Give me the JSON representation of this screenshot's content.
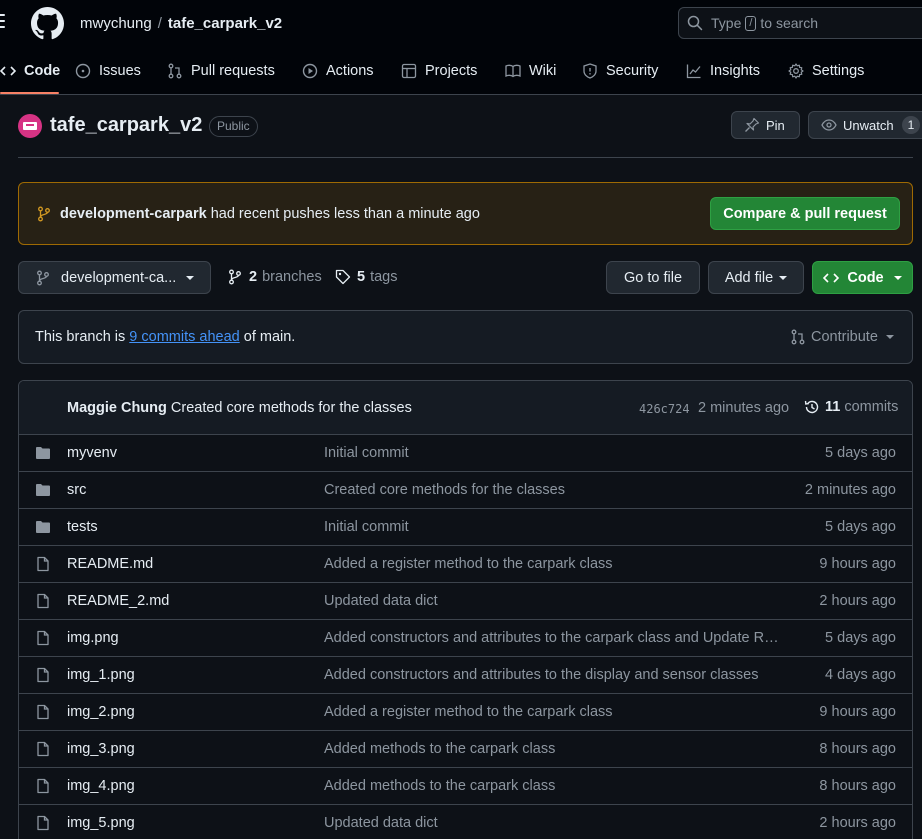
{
  "header": {
    "owner": "mwychung",
    "separator": "/",
    "repo": "tafe_carpark_v2",
    "search": {
      "prefix": "Type",
      "key": "/",
      "suffix": "to search"
    }
  },
  "nav": [
    {
      "label": "Code",
      "icon": "code-icon",
      "active": true
    },
    {
      "label": "Issues",
      "icon": "issue-opened-icon"
    },
    {
      "label": "Pull requests",
      "icon": "git-pull-request-icon"
    },
    {
      "label": "Actions",
      "icon": "play-icon"
    },
    {
      "label": "Projects",
      "icon": "table-icon"
    },
    {
      "label": "Wiki",
      "icon": "book-icon"
    },
    {
      "label": "Security",
      "icon": "shield-icon"
    },
    {
      "label": "Insights",
      "icon": "graph-icon"
    },
    {
      "label": "Settings",
      "icon": "gear-icon"
    }
  ],
  "repo": {
    "name": "tafe_carpark_v2",
    "visibility": "Public",
    "pin_label": "Pin",
    "unwatch_label": "Unwatch",
    "watchers": "1"
  },
  "banner": {
    "branch": "development-carpark",
    "message": "had recent pushes less than a minute ago",
    "button": "Compare & pull request"
  },
  "toolbar": {
    "branch_label": "development-ca...",
    "branches_count": "2",
    "branches_label": "branches",
    "tags_count": "5",
    "tags_label": "tags",
    "go_to_file": "Go to file",
    "add_file": "Add file",
    "code": "Code"
  },
  "ahead": {
    "prefix": "This branch is",
    "link": "9 commits ahead",
    "suffix": "of main.",
    "contribute": "Contribute"
  },
  "latest_commit": {
    "author": "Maggie Chung",
    "message": "Created core methods for the classes",
    "sha": "426c724",
    "ago": "2 minutes ago",
    "commits_count": "11",
    "commits_label": "commits"
  },
  "files": [
    {
      "type": "dir",
      "name": "myvenv",
      "message": "Initial commit",
      "date": "5 days ago"
    },
    {
      "type": "dir",
      "name": "src",
      "message": "Created core methods for the classes",
      "date": "2 minutes ago"
    },
    {
      "type": "dir",
      "name": "tests",
      "message": "Initial commit",
      "date": "5 days ago"
    },
    {
      "type": "file",
      "name": "README.md",
      "message": "Added a register method to the carpark class",
      "date": "9 hours ago"
    },
    {
      "type": "file",
      "name": "README_2.md",
      "message": "Updated data dict",
      "date": "2 hours ago"
    },
    {
      "type": "file",
      "name": "img.png",
      "message": "Added constructors and attributes to the carpark class and Update R…",
      "date": "5 days ago"
    },
    {
      "type": "file",
      "name": "img_1.png",
      "message": "Added constructors and attributes to the display and sensor classes",
      "date": "4 days ago"
    },
    {
      "type": "file",
      "name": "img_2.png",
      "message": "Added a register method to the carpark class",
      "date": "9 hours ago"
    },
    {
      "type": "file",
      "name": "img_3.png",
      "message": "Added methods to the carpark class",
      "date": "8 hours ago"
    },
    {
      "type": "file",
      "name": "img_4.png",
      "message": "Added methods to the carpark class",
      "date": "8 hours ago"
    },
    {
      "type": "file",
      "name": "img_5.png",
      "message": "Updated data dict",
      "date": "2 hours ago"
    }
  ],
  "colors": {
    "background": "#0d1117",
    "accent_green": "#238636",
    "link_blue": "#4493f8",
    "nav_active": "#f78166",
    "banner_border": "#9e6a03"
  }
}
